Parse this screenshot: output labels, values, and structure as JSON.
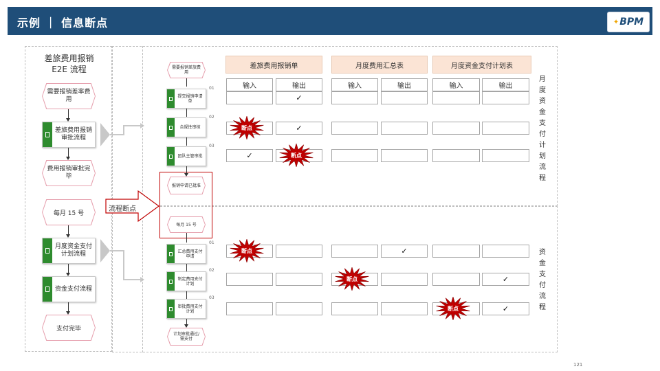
{
  "header": {
    "title": "示例 ｜ 信息断点",
    "logo_text": "BPM",
    "bg_color": "#1f4e79"
  },
  "left_panel": {
    "title": "差旅费用报销 E2E 流程",
    "nodes": [
      {
        "kind": "event",
        "label": "需要报销差率费用"
      },
      {
        "kind": "process",
        "label": "差旅费用报销审批流程"
      },
      {
        "kind": "event",
        "label": "费用报销审批完毕"
      },
      {
        "kind": "event",
        "label": "每月 15 号"
      },
      {
        "kind": "process",
        "label": "月度资金支付计划流程"
      },
      {
        "kind": "process",
        "label": "资金支付流程"
      },
      {
        "kind": "event",
        "label": "支付完毕"
      }
    ]
  },
  "callout": {
    "label": "流程断点"
  },
  "mid_flow": {
    "steps": [
      {
        "kind": "event",
        "label": "需要报销差旅费用"
      },
      {
        "kind": "task",
        "label": "提交报销申请单",
        "num": "01"
      },
      {
        "kind": "task",
        "label": "合规性审核",
        "num": "02"
      },
      {
        "kind": "task",
        "label": "团队主管审批",
        "num": "03"
      },
      {
        "kind": "event",
        "label": "报销申请已批准"
      },
      {
        "kind": "event",
        "label": "每月 15 号"
      },
      {
        "kind": "task",
        "label": "汇总费用支付申请",
        "num": "01"
      },
      {
        "kind": "task",
        "label": "制定费用支付计划",
        "num": "02"
      },
      {
        "kind": "task",
        "label": "审批费用支付计划",
        "num": "03"
      },
      {
        "kind": "event",
        "label": "计划审批通过/需支付"
      }
    ]
  },
  "docs": [
    {
      "title": "差旅费用报销单",
      "in": "输入",
      "out": "输出"
    },
    {
      "title": "月度费用汇总表",
      "in": "输入",
      "out": "输出"
    },
    {
      "title": "月度资金支付计划表",
      "in": "输入",
      "out": "输出"
    }
  ],
  "matrix": [
    [
      "",
      "✓",
      "",
      "",
      "",
      ""
    ],
    [
      "",
      "✓",
      "",
      "",
      "",
      ""
    ],
    [
      "✓",
      "",
      "",
      "",
      "",
      ""
    ],
    [
      "",
      "",
      "",
      "✓",
      "",
      ""
    ],
    [
      "",
      "",
      "",
      "",
      "",
      "✓"
    ],
    [
      "",
      "",
      "",
      "",
      "",
      "✓"
    ]
  ],
  "break_label": "断点",
  "breaks": [
    [
      1,
      0
    ],
    [
      2,
      1
    ],
    [
      3,
      0
    ],
    [
      4,
      2
    ],
    [
      5,
      4
    ]
  ],
  "side_labels": [
    "月度资金支付计划流程",
    "资金支付流程"
  ],
  "page_number": "121",
  "colors": {
    "break_red": "#c00000",
    "process_green": "#2e8b2e",
    "event_border": "#e6a0ae",
    "doc_header_bg": "#fbe4d5"
  }
}
